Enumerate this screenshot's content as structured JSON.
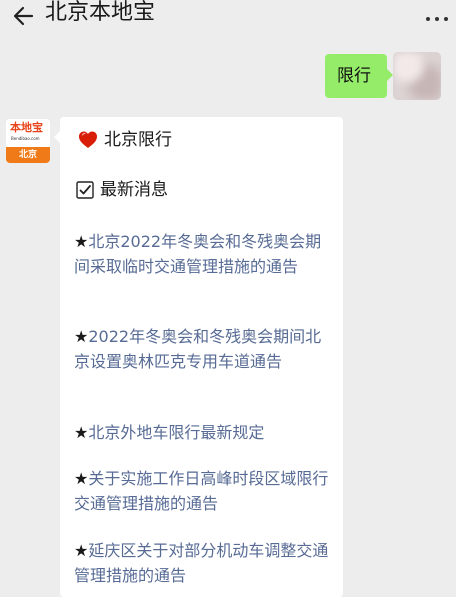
{
  "header": {
    "title": "北京本地宝"
  },
  "outgoing": {
    "text": "限行"
  },
  "bot": {
    "logo_text": "本地宝",
    "logo_url": "Bendibao.com",
    "logo_city": "北京"
  },
  "reply": {
    "heading": "北京限行",
    "section": "最新消息",
    "star": "★",
    "links": [
      "北京2022年冬奥会和冬残奥会期间采取临时交通管理措施的通告",
      "2022年冬奥会和冬残奥会期间北京设置奥林匹克专用车道通告",
      "北京外地车限行最新规定",
      "关于实施工作日高峰时段区域限行交通管理措施的通告",
      "延庆区关于对部分机动车调整交通管理措施的通告"
    ]
  },
  "colors": {
    "background": "#ededed",
    "outgoing_bubble": "#95ec69",
    "link": "#576b95",
    "heart": "#d81e06",
    "logo_orange": "#f07a17"
  },
  "icons": {
    "back": "back-arrow-icon",
    "more": "more-dots-icon",
    "heart": "heart-icon",
    "check": "checkbox-icon"
  }
}
